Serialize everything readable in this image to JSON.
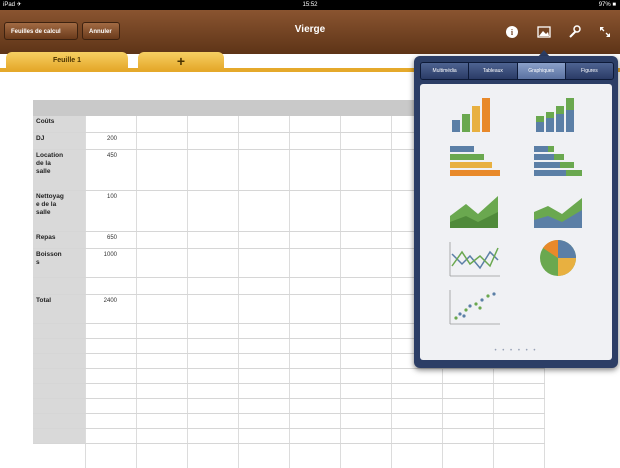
{
  "status": {
    "left": "iPad ✈",
    "time": "15:52",
    "battery": "97% ■"
  },
  "toolbar": {
    "back_label": "Feuilles de calcul",
    "cancel_label": "Annuler",
    "title": "Vierge"
  },
  "tabs": {
    "sheet1": "Feuille 1",
    "add": "+"
  },
  "sheet": {
    "rows": [
      {
        "label": "Coûts",
        "value": ""
      },
      {
        "label": "DJ",
        "value": "200"
      },
      {
        "label": "Location\nde la\nsalle",
        "value": "450"
      },
      {
        "label": "Nettoyag\ne de la\nsalle",
        "value": "100"
      },
      {
        "label": "Repas",
        "value": "650"
      },
      {
        "label": "Boisson\ns",
        "value": "1000"
      },
      {
        "label": "",
        "value": ""
      },
      {
        "label": "Total",
        "value": "2400"
      }
    ]
  },
  "insert_popover": {
    "segments": [
      "Multimédia",
      "Tableaux",
      "Graphiques",
      "Figures"
    ],
    "selected_segment": "Graphiques",
    "chart_types": [
      "column",
      "stacked-column",
      "bar",
      "stacked-bar",
      "area",
      "stacked-area",
      "line",
      "pie",
      "scatter"
    ],
    "page_dots": "• • • • • •"
  },
  "colors": {
    "toolbar": "#6f3f1f",
    "tab": "#e8b040",
    "popover": "#2c3e66",
    "chart_green": "#6aa84f",
    "chart_blue": "#5b7fa6",
    "chart_orange": "#e8892a"
  }
}
